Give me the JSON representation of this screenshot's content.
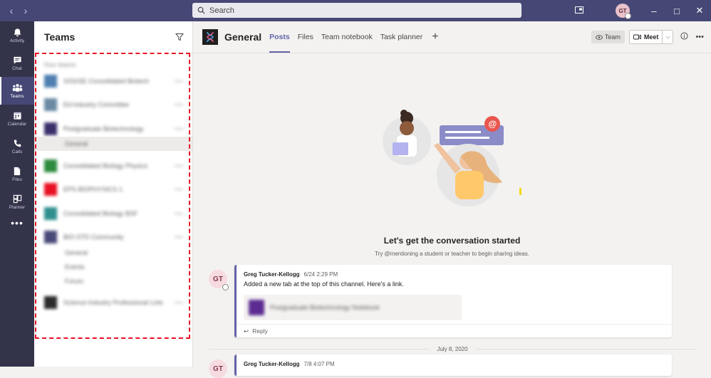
{
  "titlebar": {
    "search_placeholder": "Search",
    "user_initials": "GT"
  },
  "rail": {
    "items": [
      {
        "label": "Activity",
        "icon": "bell-icon"
      },
      {
        "label": "Chat",
        "icon": "chat-icon"
      },
      {
        "label": "Teams",
        "icon": "teams-icon",
        "active": true
      },
      {
        "label": "Calendar",
        "icon": "calendar-icon"
      },
      {
        "label": "Calls",
        "icon": "phone-icon"
      },
      {
        "label": "Files",
        "icon": "file-icon"
      },
      {
        "label": "Planner",
        "icon": "planner-icon"
      }
    ],
    "more": "•••"
  },
  "teams_panel": {
    "title": "Teams",
    "section_label": "Your teams",
    "teams": [
      {
        "name": "SSS/SE Consolidated Biotech",
        "color": "#4e7fb0"
      },
      {
        "name": "Ed-Industry Committee",
        "color": "#6a8ba3"
      },
      {
        "name": "Postgraduate Biotechnology",
        "color": "#3b2f6b"
      },
      {
        "name": "Consolidated Biology Physics",
        "color": "#2e8b3e"
      },
      {
        "name": "EPS BIOPHYSICS 1",
        "color": "#e81123"
      },
      {
        "name": "Consolidated Biology BSF",
        "color": "#2f8f8f"
      },
      {
        "name": "BIO-STD Community",
        "color": "#4a4a7a"
      },
      {
        "name": "Science-Industry Professional Links",
        "color": "#2b2b2b"
      }
    ],
    "channels": {
      "postgrad": [
        "General"
      ],
      "community": [
        "General",
        "Events",
        "Forum"
      ]
    }
  },
  "channel": {
    "name": "General",
    "tabs": [
      "Posts",
      "Files",
      "Team notebook",
      "Task planner"
    ],
    "team_button": "Team",
    "meet_button": "Meet"
  },
  "empty_state": {
    "title": "Let's get the conversation started",
    "subtitle": "Try @mentioning a student or teacher to begin sharing ideas."
  },
  "posts": [
    {
      "initials": "GT",
      "author": "Greg Tucker-Kellogg",
      "time": "6/24 2:29 PM",
      "text": "Added a new tab at the top of this channel. Here's a link.",
      "link_name": "Postgraduate Biotechnology Notebook",
      "reply": "Reply"
    },
    {
      "initials": "GT",
      "author": "Greg Tucker-Kellogg",
      "time": "7/8 4:07 PM"
    }
  ],
  "date_divider": "July 8, 2020",
  "colors": {
    "titlebar": "#464775",
    "rail": "#33344a",
    "accent": "#6264a7",
    "highlight_box": "#e81123"
  }
}
